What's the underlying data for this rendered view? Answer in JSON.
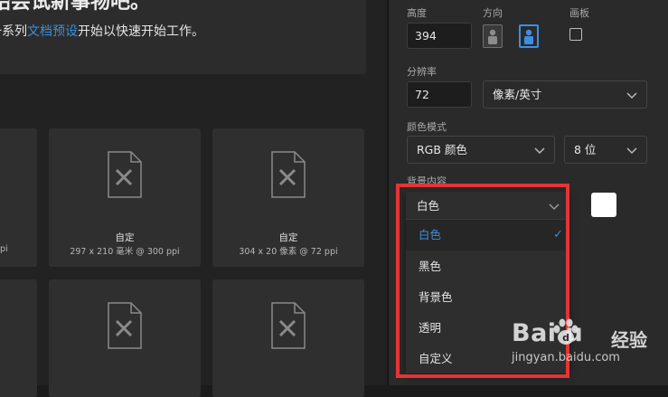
{
  "banner": {
    "title": "始尝试新事物吧。",
    "desc_prefix": "一系列",
    "desc_link": "文档预设",
    "desc_suffix": "开始以快速开始工作。"
  },
  "presets": [
    {
      "title": "",
      "sub": "ppi"
    },
    {
      "title": "自定",
      "sub": "297 x 210 毫米 @ 300 ppi"
    },
    {
      "title": "自定",
      "sub": "304 x 20 像素 @ 72 ppi"
    }
  ],
  "panel": {
    "height_label": "高度",
    "height_value": "394",
    "orientation_label": "方向",
    "artboard_label": "画板",
    "resolution_label": "分辨率",
    "resolution_value": "72",
    "resolution_unit": "像素/英寸",
    "color_mode_label": "颜色模式",
    "color_mode_value": "RGB 颜色",
    "bit_depth_value": "8 位",
    "background_label": "背景内容",
    "background_value": "白色",
    "swatch_color": "#ffffff"
  },
  "dropdown": {
    "current": "白色",
    "options": [
      "白色",
      "黑色",
      "背景色",
      "透明",
      "自定义"
    ],
    "selected_index": 0,
    "highlight_color": "#e43434",
    "accent_color": "#3e8ee0"
  },
  "watermark": {
    "logo": "Bai  u",
    "cn": "经验",
    "url": "jingyan.baidu.com"
  }
}
